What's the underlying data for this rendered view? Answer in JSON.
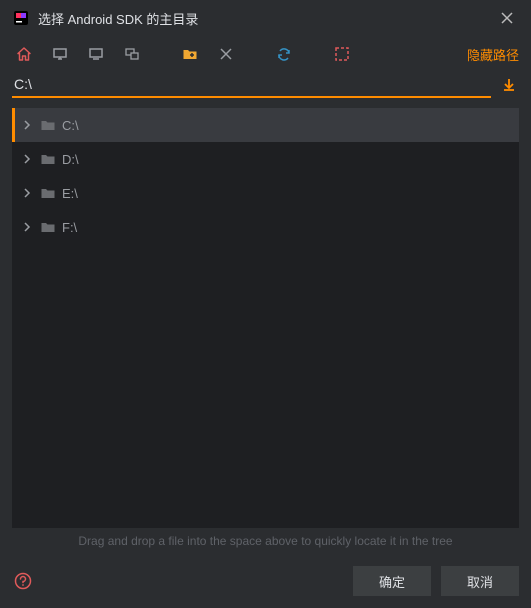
{
  "titlebar": {
    "title": "选择 Android SDK 的主目录"
  },
  "toolbar": {
    "hide_path_label": "隐藏路径"
  },
  "path": {
    "value": "C:\\"
  },
  "tree": {
    "items": [
      {
        "label": "C:\\",
        "selected": true
      },
      {
        "label": "D:\\",
        "selected": false
      },
      {
        "label": "E:\\",
        "selected": false
      },
      {
        "label": "F:\\",
        "selected": false
      }
    ]
  },
  "hints": {
    "drop": "Drag and drop a file into the space above to quickly locate it in the tree"
  },
  "buttons": {
    "ok": "确定",
    "cancel": "取消"
  }
}
